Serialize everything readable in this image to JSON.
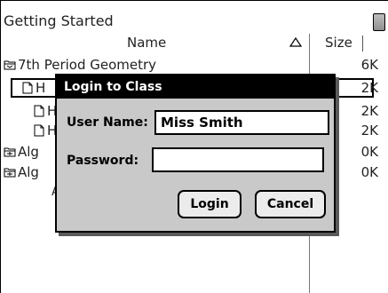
{
  "title_bar": {
    "document_title": "Getting Started",
    "battery_icon": "battery-icon"
  },
  "file_list": {
    "columns": {
      "name": "Name",
      "size": "Size"
    },
    "rows": [
      {
        "type": "folder",
        "name": "7th Period Geometry",
        "size": "6K"
      },
      {
        "type": "document",
        "name": "H",
        "size": "2K",
        "selected": true
      },
      {
        "type": "document",
        "name": "H",
        "size": "2K"
      },
      {
        "type": "document",
        "name": "H",
        "size": "2K"
      },
      {
        "type": "folder",
        "name": "Alg",
        "size": "0K"
      },
      {
        "type": "folder",
        "name": "Alg",
        "size": "0K"
      },
      {
        "type": "other",
        "name": "A",
        "size": ""
      }
    ]
  },
  "login_dialog": {
    "title": "Login to Class",
    "username_label": "User Name:",
    "username_value": "Miss Smith",
    "password_label": "Password:",
    "password_value": "",
    "login_button": "Login",
    "cancel_button": "Cancel"
  }
}
